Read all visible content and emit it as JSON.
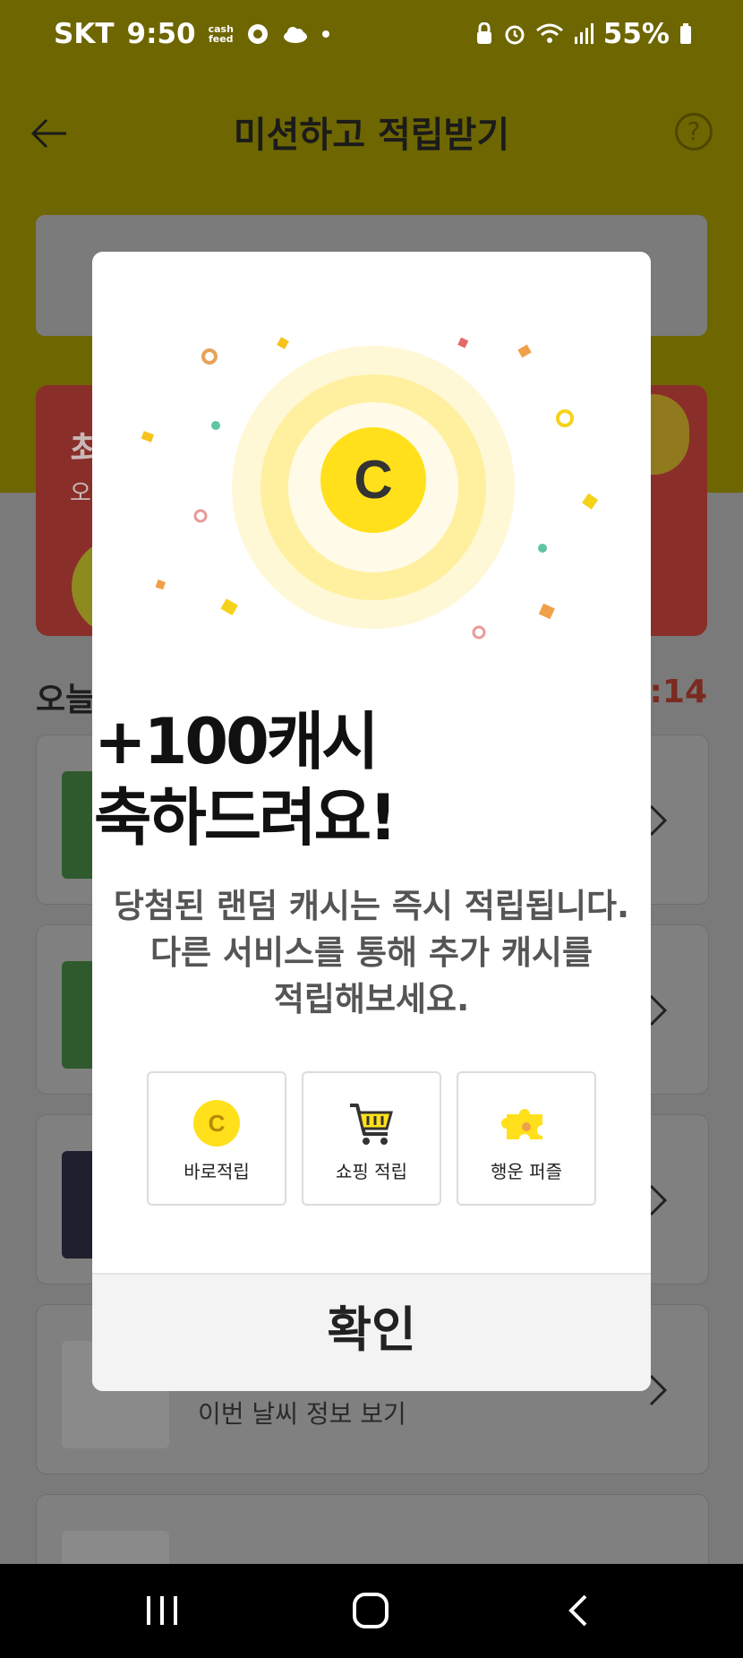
{
  "status_bar": {
    "carrier": "SKT",
    "time": "9:50",
    "cashfeed_top": "cash",
    "cashfeed_bottom": "feed",
    "battery": "55%"
  },
  "header": {
    "title": "미션하고 적립받기",
    "help": "?"
  },
  "background": {
    "red_card_title": "최",
    "red_card_sub": "오",
    "today_label": "오늘",
    "timer": "0:14",
    "list_item_4_label": "이번 날씨 정보 보기"
  },
  "modal": {
    "amount": "+100캐시",
    "congrats": "축하드려요!",
    "desc_line1": "당첨된 랜덤 캐시는 즉시 적립됩니다.",
    "desc_line2": "다른 서비스를 통해 추가 캐시를",
    "desc_line3": "적립해보세요.",
    "coin_letter": "C",
    "options": [
      {
        "label": "바로적립",
        "icon": "coin-icon"
      },
      {
        "label": "쇼핑 적립",
        "icon": "shopping-cart-icon"
      },
      {
        "label": "행운 퍼즐",
        "icon": "puzzle-icon"
      }
    ],
    "confirm": "확인"
  },
  "colors": {
    "brand_yellow": "#FFE01B",
    "coin_text": "#333333"
  }
}
